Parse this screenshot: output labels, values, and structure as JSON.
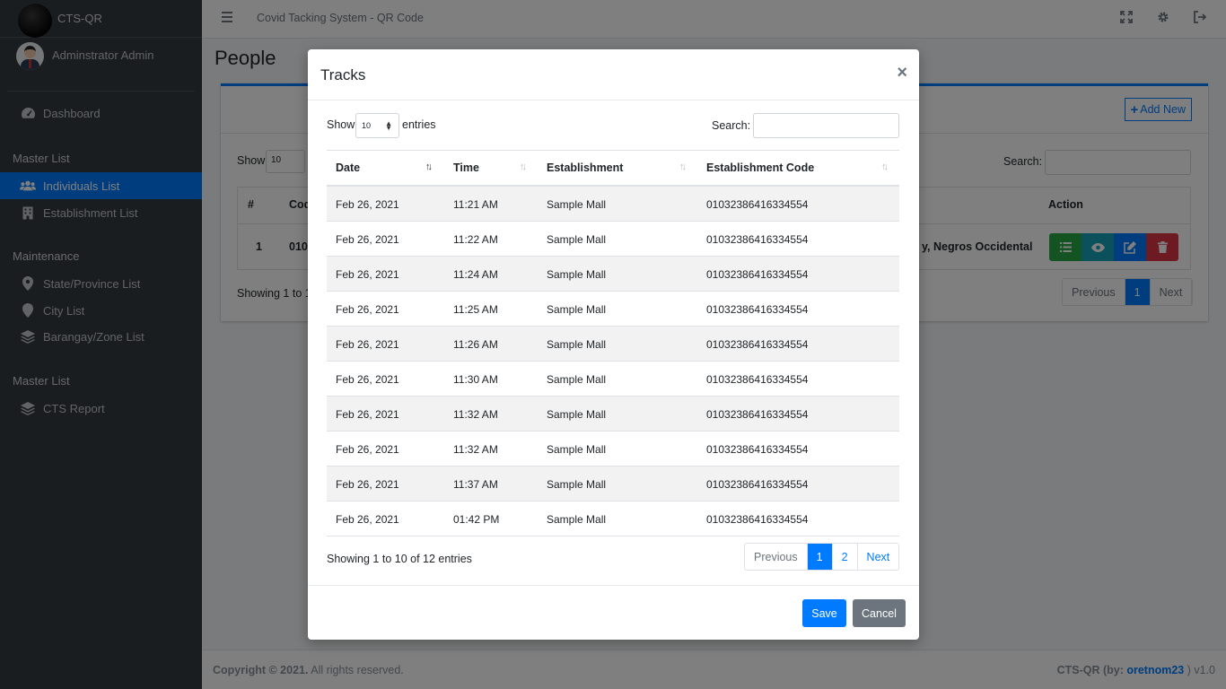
{
  "brand": {
    "text": "CTS-QR"
  },
  "user": {
    "name": "Adminstrator Admin"
  },
  "sidebar": {
    "dashboard": "Dashboard",
    "header_master": "Master List",
    "individuals": "Individuals List",
    "establishments": "Establishment List",
    "header_maintenance": "Maintenance",
    "states": "State/Province List",
    "cities": "City List",
    "barangays": "Barangay/Zone List",
    "header_master2": "Master List",
    "report": "CTS Report"
  },
  "topbar": {
    "title": "Covid Tacking System - QR Code"
  },
  "page": {
    "title": "People"
  },
  "card": {
    "add_new": "Add New",
    "show_label": "Show",
    "length_value": "10",
    "search_label": "Search:",
    "col_num": "#",
    "col_code": "Cod",
    "col_action": "Action",
    "row_num": "1",
    "row_code": "010",
    "row_address": "y, Negros Occidental",
    "showing": "Showing 1 to 1",
    "pager_prev": "Previous",
    "pager_page": "1",
    "pager_next": "Next"
  },
  "footer": {
    "copyright": "Copyright © 2021.",
    "rights": " All rights reserved.",
    "app": "CTS-QR (by: ",
    "author": "oretnom23",
    "version": " ) v1.0"
  },
  "modal": {
    "title": "Tracks",
    "close": "×",
    "show_label": "Show",
    "length_value": "10",
    "entries_label": "entries",
    "search_label": "Search:",
    "columns": [
      "Date",
      "Time",
      "Establishment",
      "Establishment Code"
    ],
    "rows": [
      [
        "Feb 26, 2021",
        "11:21 AM",
        "Sample Mall",
        "01032386416334554"
      ],
      [
        "Feb 26, 2021",
        "11:22 AM",
        "Sample Mall",
        "01032386416334554"
      ],
      [
        "Feb 26, 2021",
        "11:24 AM",
        "Sample Mall",
        "01032386416334554"
      ],
      [
        "Feb 26, 2021",
        "11:25 AM",
        "Sample Mall",
        "01032386416334554"
      ],
      [
        "Feb 26, 2021",
        "11:26 AM",
        "Sample Mall",
        "01032386416334554"
      ],
      [
        "Feb 26, 2021",
        "11:30 AM",
        "Sample Mall",
        "01032386416334554"
      ],
      [
        "Feb 26, 2021",
        "11:32 AM",
        "Sample Mall",
        "01032386416334554"
      ],
      [
        "Feb 26, 2021",
        "11:32 AM",
        "Sample Mall",
        "01032386416334554"
      ],
      [
        "Feb 26, 2021",
        "11:37 AM",
        "Sample Mall",
        "01032386416334554"
      ],
      [
        "Feb 26, 2021",
        "01:42 PM",
        "Sample Mall",
        "01032386416334554"
      ]
    ],
    "showing": "Showing 1 to 10 of 12 entries",
    "pager": {
      "prev": "Previous",
      "page1": "1",
      "page2": "2",
      "next": "Next"
    },
    "save": "Save",
    "cancel": "Cancel"
  },
  "colors": {
    "primary": "#007bff",
    "sidebar": "#343a40",
    "success": "#28a745",
    "info": "#17a2b8",
    "danger": "#dc3545",
    "secondary": "#6c757d"
  }
}
